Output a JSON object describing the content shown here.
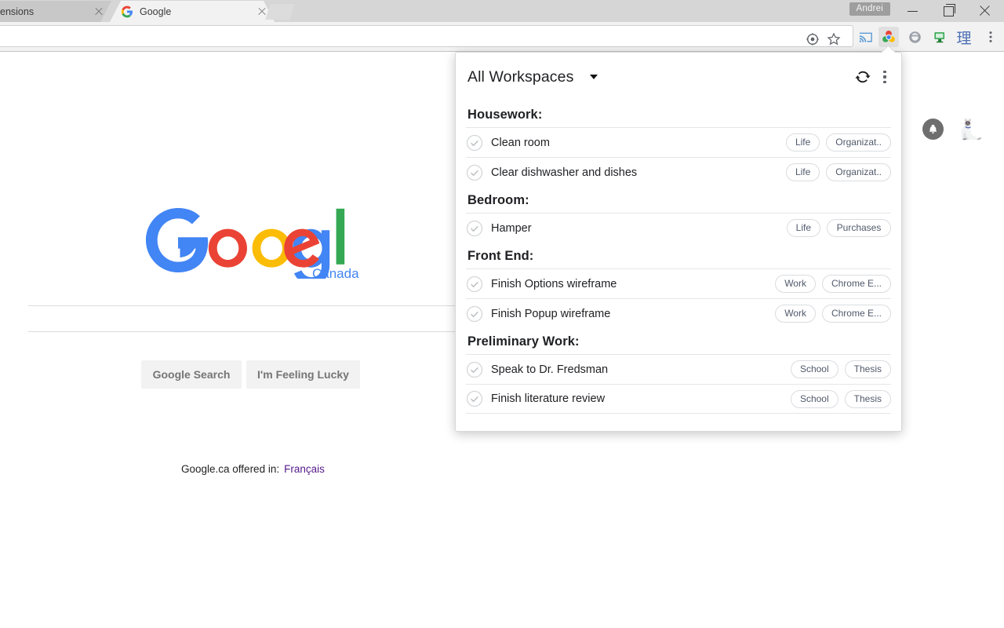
{
  "window": {
    "user_chip": "Andrei",
    "minimize_label": "Minimize",
    "maximize_label": "Restore",
    "close_label": "Close"
  },
  "tabs": [
    {
      "title": "ensions",
      "favicon": "none",
      "active": false
    },
    {
      "title": "Google",
      "favicon": "google-favicon",
      "active": true
    }
  ],
  "toolbar": {
    "omnibox_value": "",
    "omnibox_placeholder": "",
    "icons": [
      "page-info-icon",
      "bookmark-star-icon",
      "cast-icon",
      "workspaces-extension-icon",
      "extension-gray-icon",
      "extension-monitor-icon",
      "translate-icon",
      "chrome-menu-icon"
    ],
    "translate_glyph": "理"
  },
  "page": {
    "logo_text": "Google",
    "country_label": "Canada",
    "search_value": "",
    "search_placeholder": "",
    "search_button": "Google Search",
    "lucky_button": "I'm Feeling Lucky",
    "offered_text": "Google.ca offered in:",
    "offered_language": "Français",
    "notification_icon": "bell-icon",
    "avatar_icon": "cat-avatar"
  },
  "popup": {
    "title": "All Workspaces",
    "dropdown_icon": "chevron-down-icon",
    "refresh_icon": "refresh-icon",
    "menu_icon": "kebab-menu-icon",
    "sections": [
      {
        "heading": "Housework:",
        "tasks": [
          {
            "label": "Clean room",
            "tags": [
              "Life",
              "Organizat.."
            ]
          },
          {
            "label": "Clear dishwasher and dishes",
            "tags": [
              "Life",
              "Organizat.."
            ]
          }
        ]
      },
      {
        "heading": "Bedroom:",
        "tasks": [
          {
            "label": "Hamper",
            "tags": [
              "Life",
              "Purchases"
            ]
          }
        ]
      },
      {
        "heading": "Front End:",
        "tasks": [
          {
            "label": "Finish Options wireframe",
            "tags": [
              "Work",
              "Chrome E..."
            ]
          },
          {
            "label": "Finish Popup wireframe",
            "tags": [
              "Work",
              "Chrome E..."
            ]
          }
        ]
      },
      {
        "heading": "Preliminary Work:",
        "tasks": [
          {
            "label": "Speak to Dr. Fredsman",
            "tags": [
              "School",
              "Thesis"
            ]
          },
          {
            "label": "Finish literature review",
            "tags": [
              "School",
              "Thesis"
            ]
          }
        ]
      }
    ]
  },
  "colors": {
    "google_blue": "#4285f4",
    "google_red": "#ea4335",
    "google_yellow": "#fbbc05",
    "google_green": "#34a853",
    "visited_link": "#551a8b",
    "tag_text": "#50596b",
    "popup_border": "#d8d8d8"
  }
}
